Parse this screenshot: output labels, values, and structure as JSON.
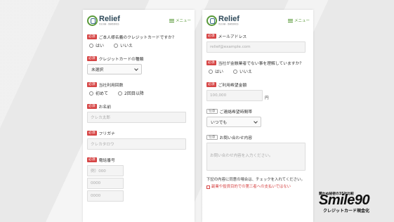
{
  "left": {
    "logo": {
      "name": "Relief",
      "sub": "借金減額・債務整理相談",
      "mark": "relief-logo-icon"
    },
    "menu": {
      "label": "メニュー",
      "icon": "hamburger-icon"
    },
    "q_card_owner": {
      "badge": "必須",
      "text": "ご本人様名義のクレジットカードですか?",
      "yes": "はい",
      "no": "いいえ"
    },
    "q_card_type": {
      "badge": "必須",
      "text": "クレジットカードの種類",
      "selected": "未選択"
    },
    "q_usage_count": {
      "badge": "必須",
      "text": "当社利用回数",
      "opt1": "初めて",
      "opt2": "2回目以降"
    },
    "q_name": {
      "badge": "必須",
      "text": "お名前",
      "placeholder": "クレカ太郎"
    },
    "q_kana": {
      "badge": "必須",
      "text": "フリガナ",
      "placeholder": "クレカタロウ"
    },
    "q_tel": {
      "badge": "必須",
      "text": "電話番号",
      "p1": "例）000",
      "p2": "0000",
      "p3": "0000"
    }
  },
  "right": {
    "logo": {
      "name": "Relief",
      "sub": "借金減額・債務整理相談",
      "mark": "relief-logo-icon"
    },
    "menu": {
      "label": "メニュー",
      "icon": "hamburger-icon"
    },
    "q_email": {
      "badge": "必須",
      "text": "メールアドレス",
      "placeholder": "relief@example.com"
    },
    "q_not_finance": {
      "badge": "必須",
      "text": "当社が金融業者でない事を理解していますか?",
      "yes": "はい",
      "no": "いいえ"
    },
    "q_amount": {
      "badge": "必須",
      "text": "ご利用希望金額",
      "placeholder": "100,000",
      "unit": "円"
    },
    "q_contact_time": {
      "badge": "任意",
      "text": "ご連絡希望時間帯",
      "selected": "いつでも"
    },
    "q_inquiry": {
      "badge": "任意",
      "text": "お問い合わせ内容",
      "placeholder": "お問い合わせ内容を入力ください。"
    },
    "consent": {
      "text": "下記の内容に同意の場合は、チェックを入れてください。",
      "label": "副業や投資目的での第三者への支払いではない"
    }
  },
  "brand": {
    "tag": "聞かぬ秘密の35社比較",
    "main": "Smile90",
    "sub": "クレジットカード現金化"
  }
}
